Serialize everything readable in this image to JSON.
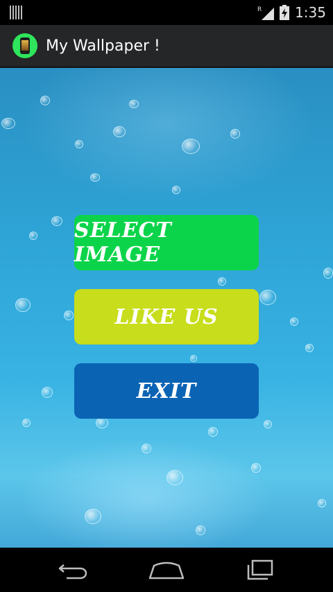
{
  "status_bar": {
    "time": "1:35",
    "roaming_indicator": "R",
    "icons": [
      "notification-icon",
      "signal-icon",
      "battery-charging-icon"
    ]
  },
  "action_bar": {
    "title": "My Wallpaper !",
    "icon": "app-icon"
  },
  "buttons": [
    {
      "label": "SELECT IMAGE",
      "color": "#0bd44a"
    },
    {
      "label": "LIKE US",
      "color": "#c8dd1c"
    },
    {
      "label": "EXIT",
      "color": "#0b63b4"
    }
  ],
  "nav_bar": {
    "icons": [
      "back-icon",
      "home-icon",
      "recent-apps-icon"
    ]
  }
}
